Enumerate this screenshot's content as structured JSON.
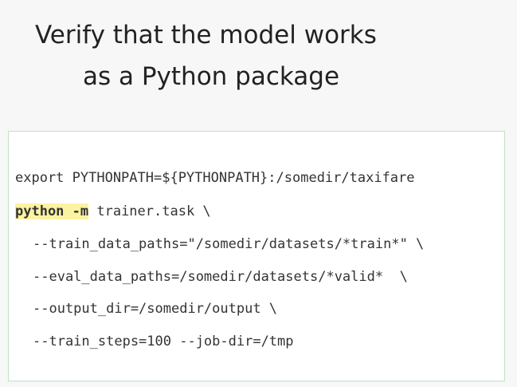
{
  "slide": {
    "title_line1": "Verify that the model works",
    "title_line2": "as a Python package"
  },
  "code": {
    "line1": "export PYTHONPATH=${PYTHONPATH}:/somedir/taxifare",
    "line2_highlight": "python -m",
    "line2_rest": " trainer.task \\",
    "line3": "--train_data_paths=\"/somedir/datasets/*train*\" \\",
    "line4": "--eval_data_paths=/somedir/datasets/*valid*  \\",
    "line5": "--output_dir=/somedir/output \\",
    "line6": "--train_steps=100 --job-dir=/tmp"
  },
  "colors": {
    "highlight": "#fbf3a0",
    "code_border": "#bfe3c6",
    "background": "#f7f7f7"
  }
}
